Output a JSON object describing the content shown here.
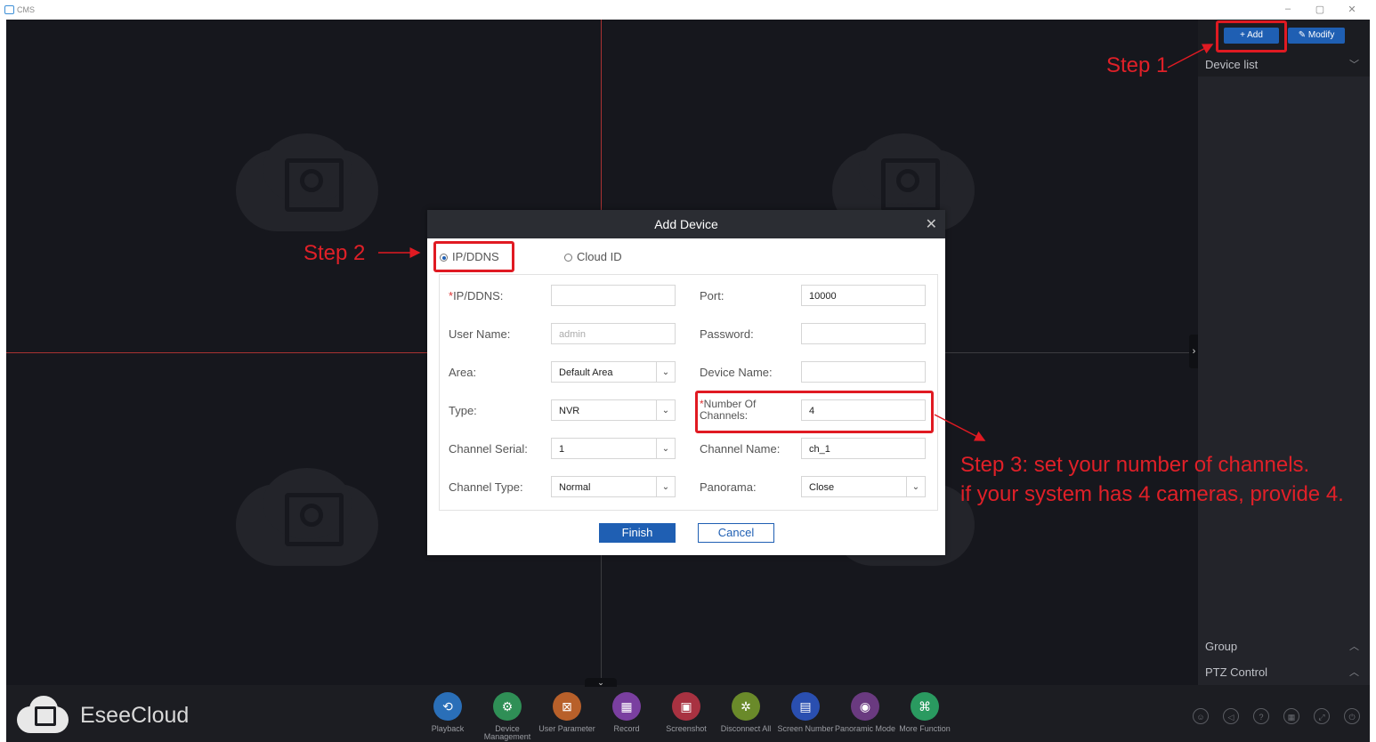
{
  "window": {
    "title": "CMS",
    "minimize": "–",
    "maximize": "▢",
    "close": "✕"
  },
  "panel": {
    "add_label": "+  Add",
    "modify_label": "Modify",
    "device_list": "Device list",
    "group": "Group",
    "ptz": "PTZ Control"
  },
  "brand": "EseeCloud",
  "toolbar": [
    {
      "label": "Playback",
      "color": "#2a6fb8",
      "glyph": "⟲"
    },
    {
      "label": "Device Management",
      "color": "#2f8f56",
      "glyph": "⚙"
    },
    {
      "label": "User Parameter",
      "color": "#b8602a",
      "glyph": "⊠"
    },
    {
      "label": "Record",
      "color": "#7a3fa0",
      "glyph": "▦"
    },
    {
      "label": "Screenshot",
      "color": "#a83241",
      "glyph": "▣"
    },
    {
      "label": "Disconnect All",
      "color": "#6a8a2a",
      "glyph": "✲"
    },
    {
      "label": "Screen Number",
      "color": "#2a4fb0",
      "glyph": "▤"
    },
    {
      "label": "Panoramic Mode",
      "color": "#6a3a80",
      "glyph": "◉"
    },
    {
      "label": "More Function",
      "color": "#2a9a60",
      "glyph": "⌘"
    }
  ],
  "dialog": {
    "title": "Add Device",
    "close": "✕",
    "radio_ip": "IP/DDNS",
    "radio_cloud": "Cloud ID",
    "fields": {
      "ip_label": "IP/DDNS:",
      "ip_value": "",
      "port_label": "Port:",
      "port_value": "10000",
      "user_label": "User Name:",
      "user_placeholder": "admin",
      "password_label": "Password:",
      "password_value": "",
      "area_label": "Area:",
      "area_value": "Default Area",
      "device_name_label": "Device Name:",
      "device_name_value": "",
      "type_label": "Type:",
      "type_value": "NVR",
      "channels_label": "Number Of Channels:",
      "channels_value": "4",
      "serial_label": "Channel Serial:",
      "serial_value": "1",
      "channel_name_label": "Channel Name:",
      "channel_name_value": "ch_1",
      "ctype_label": "Channel Type:",
      "ctype_value": "Normal",
      "panorama_label": "Panorama:",
      "panorama_value": "Close"
    },
    "finish": "Finish",
    "cancel": "Cancel"
  },
  "annotations": {
    "step1": "Step 1",
    "step2": "Step 2",
    "step3_line1": "Step 3: set your number of channels.",
    "step3_line2": "if your system has 4 cameras, provide 4."
  },
  "colors": {
    "accent": "#1f5fb3",
    "annotation": "#e01a22",
    "background": "#16171d"
  }
}
